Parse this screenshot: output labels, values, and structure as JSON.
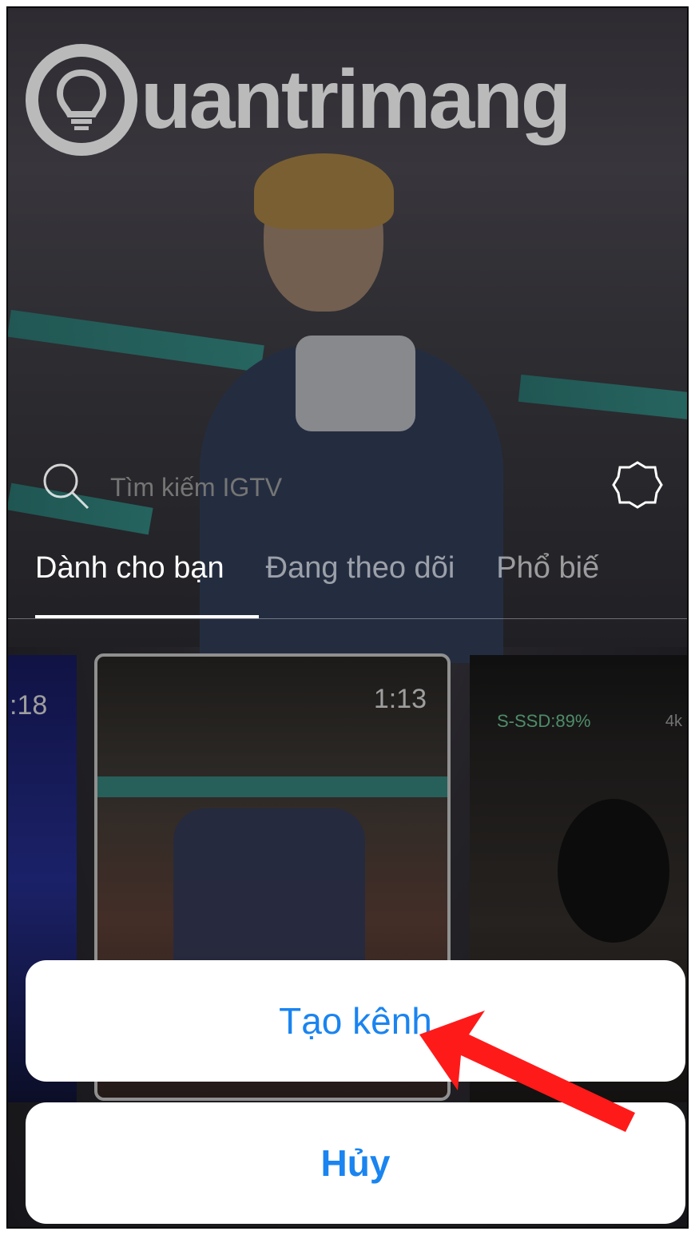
{
  "logo": {
    "text": "uantrimang"
  },
  "search": {
    "placeholder": "Tìm kiếm IGTV"
  },
  "tabs": [
    {
      "label": "Dành cho bạn"
    },
    {
      "label": "Đang theo dõi"
    },
    {
      "label": "Phổ biế"
    }
  ],
  "cards": [
    {
      "duration": ":18"
    },
    {
      "duration": "1:13"
    },
    {
      "overlay_text": "S-SSD:89%",
      "corner_text": "4k"
    }
  ],
  "action_sheet": {
    "create_label": "Tạo kênh",
    "cancel_label": "Hủy"
  },
  "colors": {
    "accent": "#1a84f0",
    "arrow": "#ff1a1a",
    "banner": "#3cc2b5"
  }
}
